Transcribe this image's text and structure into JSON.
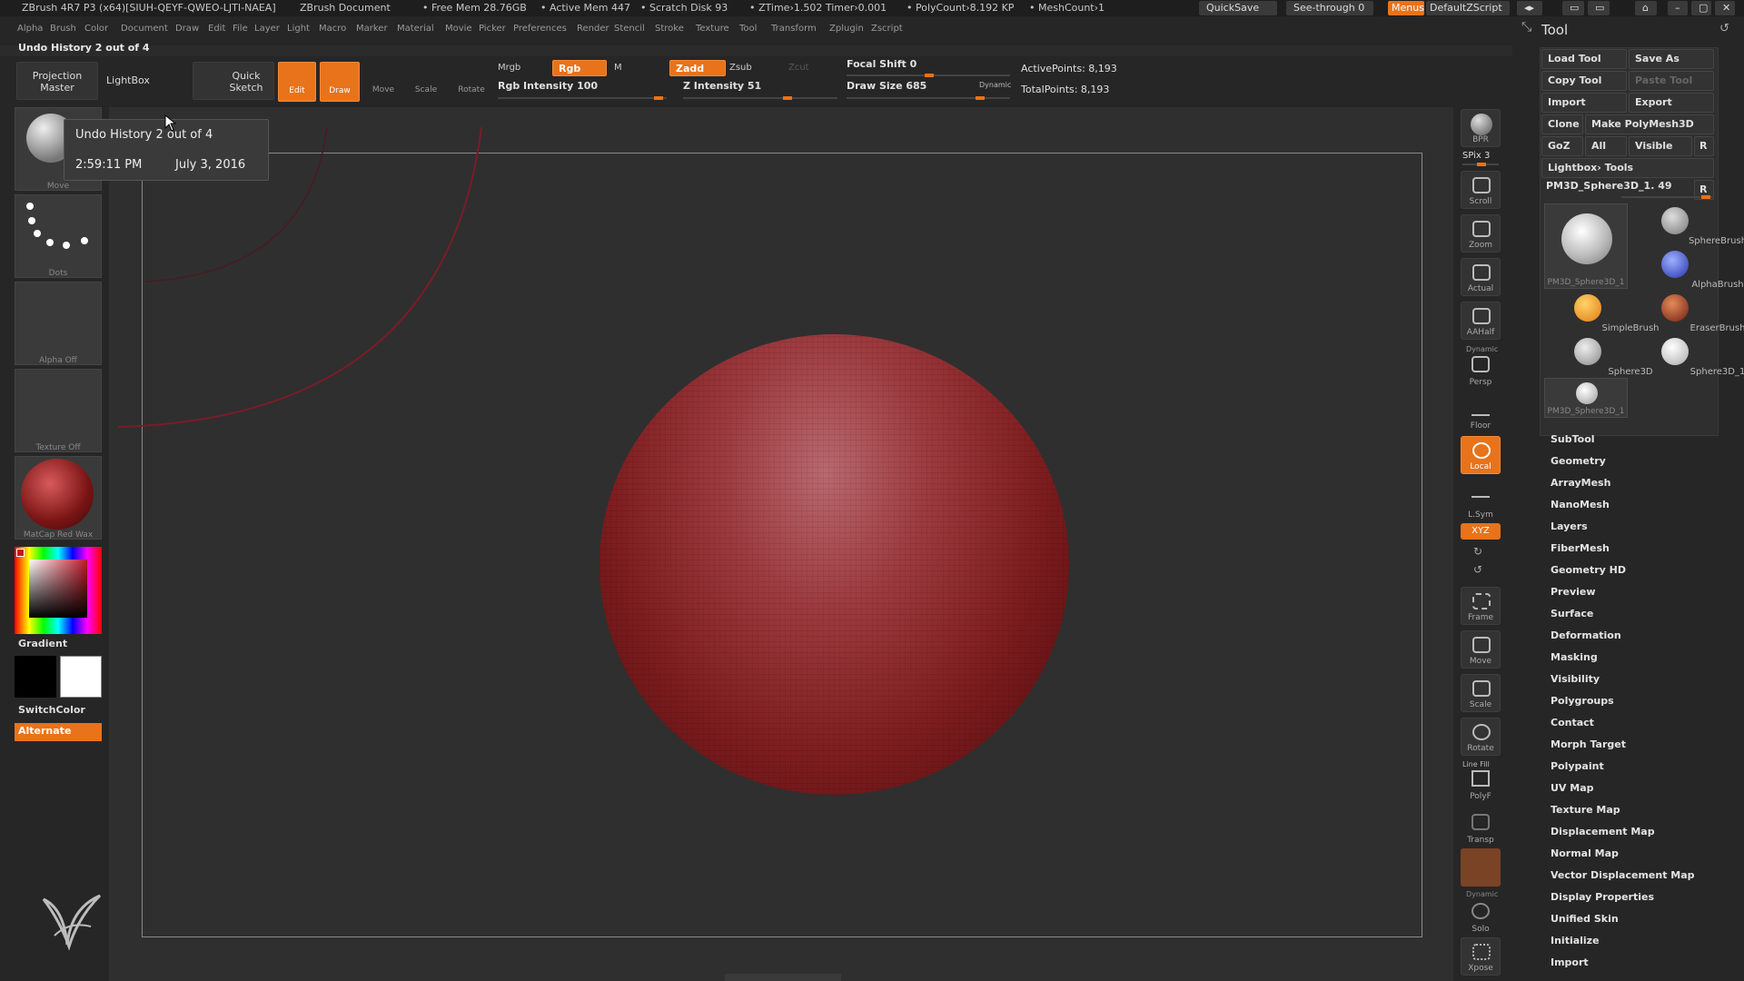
{
  "titlebar": {
    "app": "ZBrush 4R7 P3 (x64)[SIUH-QEYF-QWEO-LJTI-NAEA]",
    "doc": "ZBrush Document",
    "free_mem": "• Free Mem 28.76GB",
    "active_mem": "• Active Mem 447",
    "scratch": "• Scratch Disk 93",
    "ztime": "• ZTime›1.502 Timer›0.001",
    "polycount": "• PolyCount›8.192 KP",
    "meshcount": "• MeshCount›1",
    "quicksave": "QuickSave",
    "see_through": "See-through   0",
    "menus": "Menus",
    "script": "DefaultZScript"
  },
  "menubar": {
    "items": [
      "Alpha",
      "Brush",
      "Color",
      "Document",
      "Draw",
      "Edit",
      "File",
      "Layer",
      "Light",
      "Macro",
      "Marker",
      "Material",
      "Movie",
      "Picker",
      "Preferences",
      "Render",
      "Stencil",
      "Stroke",
      "Texture",
      "Tool",
      "Transform",
      "Zplugin",
      "Zscript"
    ]
  },
  "undo_label": "Undo History 2 out of 4",
  "toolbar": {
    "projection_master": "Projection Master",
    "lightbox": "LightBox",
    "quick_sketch": "Quick Sketch",
    "edit": "Edit",
    "draw": "Draw",
    "move": "Move",
    "scale": "Scale",
    "rotate": "Rotate",
    "mrgb": "Mrgb",
    "rgb": "Rgb",
    "m": "M",
    "zadd": "Zadd",
    "zsub": "Zsub",
    "zcut": "Zcut",
    "rgb_intensity": "Rgb Intensity 100",
    "z_intensity": "Z Intensity 51",
    "focal_shift": "Focal Shift 0",
    "draw_size": "Draw Size 685",
    "dynamic": "Dynamic",
    "active_points": "ActivePoints: 8,193",
    "total_points": "TotalPoints: 8,193"
  },
  "tooltip": {
    "line1": "Undo History 2 out of 4",
    "time": "2:59:11 PM",
    "date": "July 3, 2016"
  },
  "leftpanel": {
    "brush_cap": "Move",
    "stroke_cap": "Dots",
    "alpha_cap": "Alpha  Off",
    "texture_cap": "Texture  Off",
    "material_cap": "MatCap Red Wax",
    "gradient": "Gradient",
    "switchcolor": "SwitchColor",
    "alternate": "Alternate"
  },
  "rshelf": {
    "bpr": "BPR",
    "spix": "SPix 3",
    "scroll": "Scroll",
    "zoom": "Zoom",
    "actual": "Actual",
    "aahalf": "AAHalf",
    "dynamic": "Dynamic",
    "persp": "Persp",
    "floor": "Floor",
    "local": "Local",
    "lsym": "L.Sym",
    "xyz": "XYZ",
    "frame": "Frame",
    "move": "Move",
    "scale": "Scale",
    "rotate": "Rotate",
    "line_fill": "Line Fill",
    "polyf": "PolyF",
    "transp": "Transp",
    "dynamic2": "Dynamic",
    "solo": "Solo",
    "xpose": "Xpose"
  },
  "toolpanel": {
    "title": "Tool",
    "load_tool": "Load Tool",
    "save_as": "Save As",
    "copy_tool": "Copy Tool",
    "paste_tool": "Paste Tool",
    "import": "Import",
    "export": "Export",
    "clone": "Clone",
    "make_polymesh": "Make PolyMesh3D",
    "goz": "GoZ",
    "all": "All",
    "visible": "Visible",
    "r": "R",
    "lightbox_tools": "Lightbox› Tools",
    "current_tool": "PM3D_Sphere3D_1. 49",
    "brushes": {
      "big": "PM3D_Sphere3D_1",
      "spherebrush": "SphereBrush",
      "alphabrush": "AlphaBrush",
      "simplebrush": "SimpleBrush",
      "eraserbrush": "EraserBrush",
      "sphere3d": "Sphere3D",
      "sphere3d_1": "Sphere3D_1",
      "pm3d_small": "PM3D_Sphere3D_1"
    },
    "menu": [
      "SubTool",
      "Geometry",
      "ArrayMesh",
      "NanoMesh",
      "Layers",
      "FiberMesh",
      "Geometry HD",
      "Preview",
      "Surface",
      "Deformation",
      "Masking",
      "Visibility",
      "Polygroups",
      "Contact",
      "Morph Target",
      "Polypaint",
      "UV Map",
      "Texture Map",
      "Displacement Map",
      "Normal Map",
      "Vector Displacement Map",
      "Display Properties",
      "Unified Skin",
      "Initialize",
      "Import"
    ]
  },
  "colors": {
    "accent": "#e8731a",
    "sphere": "#9a2a2a"
  }
}
